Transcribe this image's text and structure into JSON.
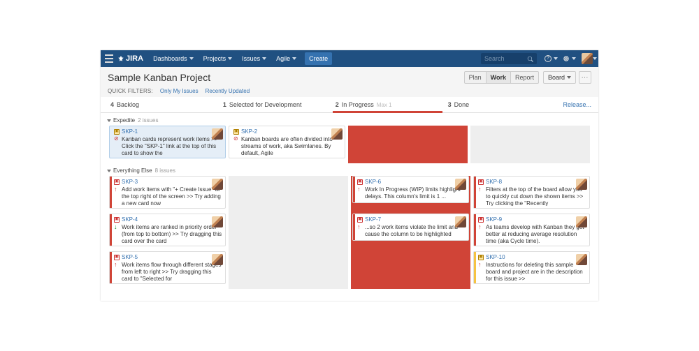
{
  "navbar": {
    "logo": "JIRA",
    "menu": [
      "Dashboards",
      "Projects",
      "Issues",
      "Agile"
    ],
    "create": "Create",
    "search_placeholder": "Search"
  },
  "header": {
    "title": "Sample Kanban Project",
    "views": [
      "Plan",
      "Work",
      "Report"
    ],
    "active_view": "Work",
    "board_button": "Board",
    "quick_filters_label": "QUICK FILTERS:",
    "quick_filters": [
      "Only My Issues",
      "Recently Updated"
    ]
  },
  "columns": [
    {
      "count": "4",
      "name": "Backlog"
    },
    {
      "count": "1",
      "name": "Selected for Development"
    },
    {
      "count": "2",
      "name": "In Progress",
      "max": "Max 1",
      "over": true
    },
    {
      "count": "3",
      "name": "Done"
    }
  ],
  "release_label": "Release...",
  "lanes": [
    {
      "name": "Expedite",
      "sub": "2 issues",
      "rows": [
        {
          "backlog": {
            "key": "SKP-1",
            "type": "yellow",
            "pri": "block",
            "txt": "Kanban cards represent work items >> Click the \"SKP-1\" link at the top of this card to show the",
            "sel": true
          },
          "selected": {
            "key": "SKP-2",
            "type": "yellow",
            "pri": "block",
            "txt": "Kanban boards are often divided into streams of work, aka Swimlanes. By default, Agile"
          },
          "progress": "over",
          "done": "drop"
        }
      ]
    },
    {
      "name": "Everything Else",
      "sub": "8 issues",
      "rows": [
        {
          "backlog": {
            "key": "SKP-3",
            "type": "red",
            "pri": "up",
            "txt": "Add work items with \"+ Create Issue\" at the top right of the screen >> Try adding a new card now",
            "stripe": "red"
          },
          "selected": "drop",
          "progress": {
            "key": "SKP-6",
            "type": "red",
            "pri": "up",
            "txt": "Work In Progress (WIP) limits highlight delays. This column's limit is 1 ...",
            "stripe": "red",
            "over": true
          },
          "done": {
            "key": "SKP-8",
            "type": "red",
            "pri": "up",
            "txt": "Filters at the top of the board allow you to quickly cut down the shown items >> Try clicking the \"Recently",
            "stripe": "red"
          }
        },
        {
          "backlog": {
            "key": "SKP-4",
            "type": "red",
            "pri": "down",
            "txt": "Work items are ranked in priority order (from top to bottom) >> Try dragging this card over the card",
            "stripe": "red"
          },
          "selected": "drop",
          "progress": {
            "key": "SKP-7",
            "type": "red",
            "pri": "up",
            "txt": "...so 2 work items violate the limit and cause the column to be highlighted",
            "stripe": "red",
            "over": true
          },
          "done": {
            "key": "SKP-9",
            "type": "red",
            "pri": "up",
            "txt": "As teams develop with Kanban they get better at reducing average resolution time (aka Cycle time).",
            "stripe": "red"
          }
        },
        {
          "backlog": {
            "key": "SKP-5",
            "type": "red",
            "pri": "up",
            "txt": "Work items flow through different stages from left to right >> Try dragging this card to \"Selected for",
            "stripe": "red"
          },
          "selected": "drop",
          "progress": "over",
          "done": {
            "key": "SKP-10",
            "type": "yellow",
            "pri": "up",
            "txt": "Instructions for deleting this sample board and project are in the description for this issue >>",
            "stripe": "yellow"
          }
        }
      ]
    }
  ]
}
